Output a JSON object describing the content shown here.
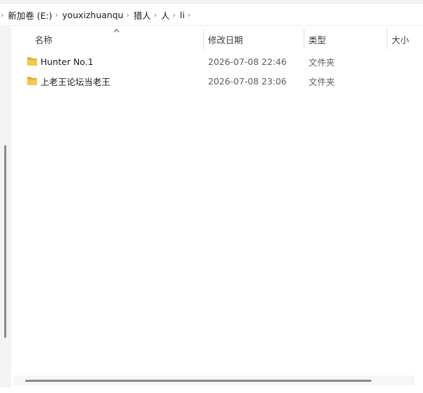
{
  "breadcrumb": {
    "items": [
      {
        "label": "新加卷 (E:)"
      },
      {
        "label": "youxizhuanqu"
      },
      {
        "label": "猎人"
      },
      {
        "label": "人"
      },
      {
        "label": "li"
      }
    ],
    "separator": "›"
  },
  "columns": {
    "name": "名称",
    "date": "修改日期",
    "type": "类型",
    "size": "大小"
  },
  "files": [
    {
      "name": "Hunter No.1",
      "date": "2026-07-08 22:46",
      "type": "文件夹",
      "icon": "folder-icon"
    },
    {
      "name": "上老王论坛当老王",
      "date": "2026-07-08 23:06",
      "type": "文件夹",
      "icon": "folder-icon"
    }
  ],
  "colors": {
    "folder": "#f4c74d",
    "folder_dark": "#e2a92c",
    "scrollbar": "#8a8a8a"
  }
}
